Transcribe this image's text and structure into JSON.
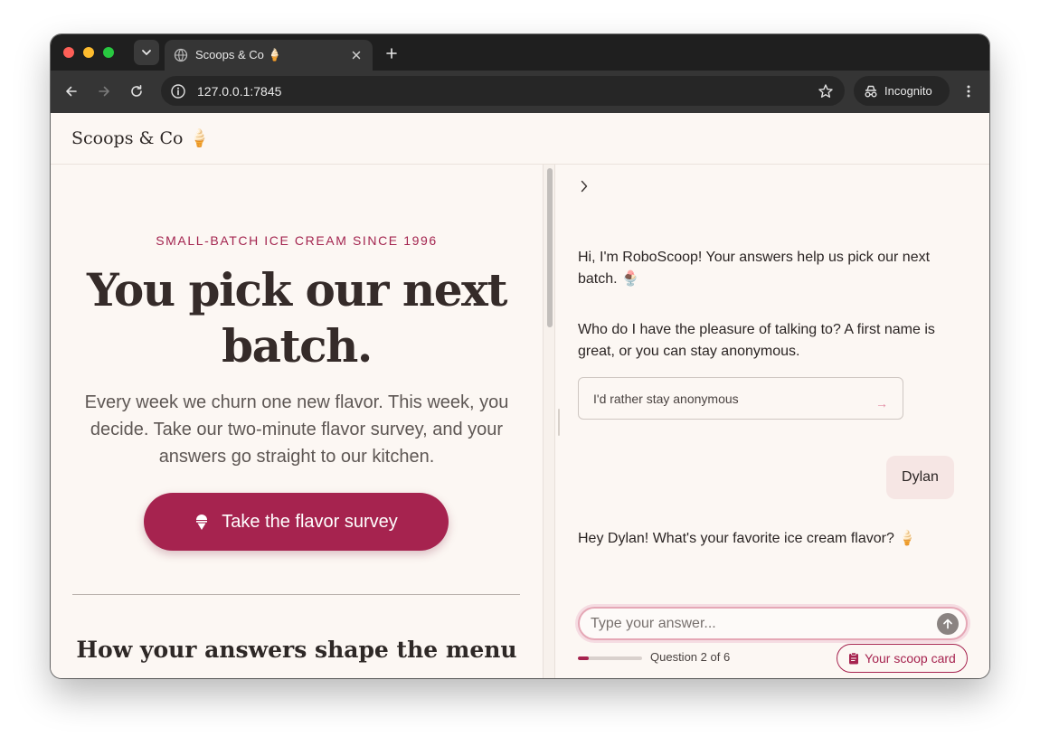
{
  "browser": {
    "tab_title": "Scoops & Co 🍦",
    "url": "127.0.0.1:7845",
    "incognito_label": "Incognito"
  },
  "site": {
    "brand": "Scoops & Co 🍦"
  },
  "hero": {
    "eyebrow": "SMALL-BATCH ICE CREAM SINCE 1996",
    "title": "You pick our next batch.",
    "subtitle": "Every week we churn one new flavor. This week, you decide. Take our two-minute flavor survey, and your answers go straight to our kitchen.",
    "cta_label": "Take the flavor survey",
    "section_title": "How your answers shape the menu"
  },
  "chat": {
    "messages": [
      {
        "role": "bot",
        "text": "Hi, I'm RoboScoop! Your answers help us pick our next batch. 🍨"
      },
      {
        "role": "bot",
        "text": "Who do I have the pleasure of talking to? A first name is great, or you can stay anonymous."
      },
      {
        "role": "user",
        "text": "Dylan"
      },
      {
        "role": "bot",
        "text": "Hey Dylan! What's your favorite ice cream flavor? 🍦"
      }
    ],
    "quick_reply": {
      "label": "I'd rather stay anonymous",
      "arrow": "→"
    },
    "composer": {
      "placeholder": "Type your answer...",
      "value": ""
    },
    "progress": {
      "label": "Question 2 of 6",
      "fraction": 0.17
    },
    "scoop_card_label": "Your scoop card"
  },
  "colors": {
    "accent": "#a6234f",
    "background": "#fcf7f3",
    "user_bubble": "#f6e6e4"
  }
}
